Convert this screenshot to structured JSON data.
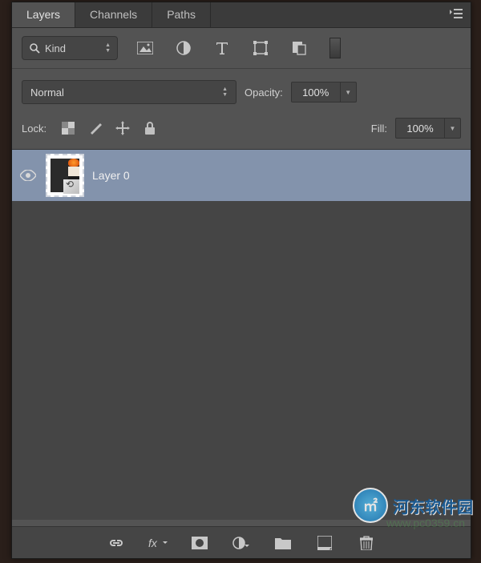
{
  "tabs": {
    "layers": "Layers",
    "channels": "Channels",
    "paths": "Paths"
  },
  "filter": {
    "kind": "Kind"
  },
  "blend": {
    "mode": "Normal",
    "opacity_label": "Opacity:",
    "opacity_value": "100%"
  },
  "lock": {
    "label": "Lock:",
    "fill_label": "Fill:",
    "fill_value": "100%"
  },
  "layers": [
    {
      "name": "Layer 0",
      "visible": true,
      "selected": true
    }
  ],
  "watermark": {
    "text": "河东软件园",
    "url": "www.pc0359.cn"
  }
}
